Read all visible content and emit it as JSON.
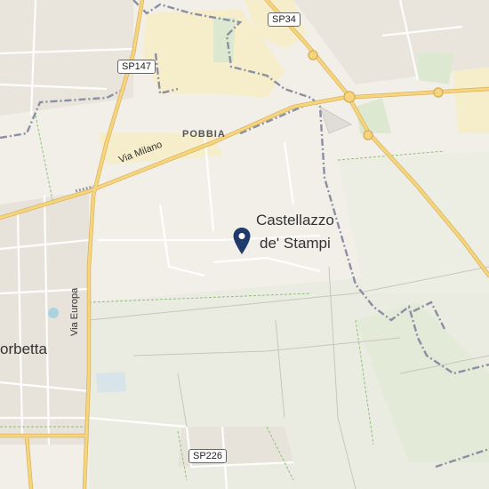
{
  "map": {
    "places": {
      "castellazzo_line1": "Castellazzo",
      "castellazzo_line2": "de' Stampi",
      "pobbia": "POBBIA",
      "corbetta": "orbetta"
    },
    "roads": {
      "via_milano": "Via Milano",
      "via_europa": "Via Europa"
    },
    "shields": {
      "sp34": "SP34",
      "sp147": "SP147",
      "sp226": "SP226"
    },
    "marker": {
      "icon": "map-pin-icon",
      "color": "#1f3a6b"
    },
    "colors": {
      "land": "#f2efe9",
      "field": "#e9eadf",
      "residential": "#e8e4dc",
      "industrial": "#f7eecb",
      "main_road": "#f4c86a",
      "minor_road": "#ffffff",
      "boundary": "#8b8fa3",
      "park": "#dfe9d4"
    }
  }
}
